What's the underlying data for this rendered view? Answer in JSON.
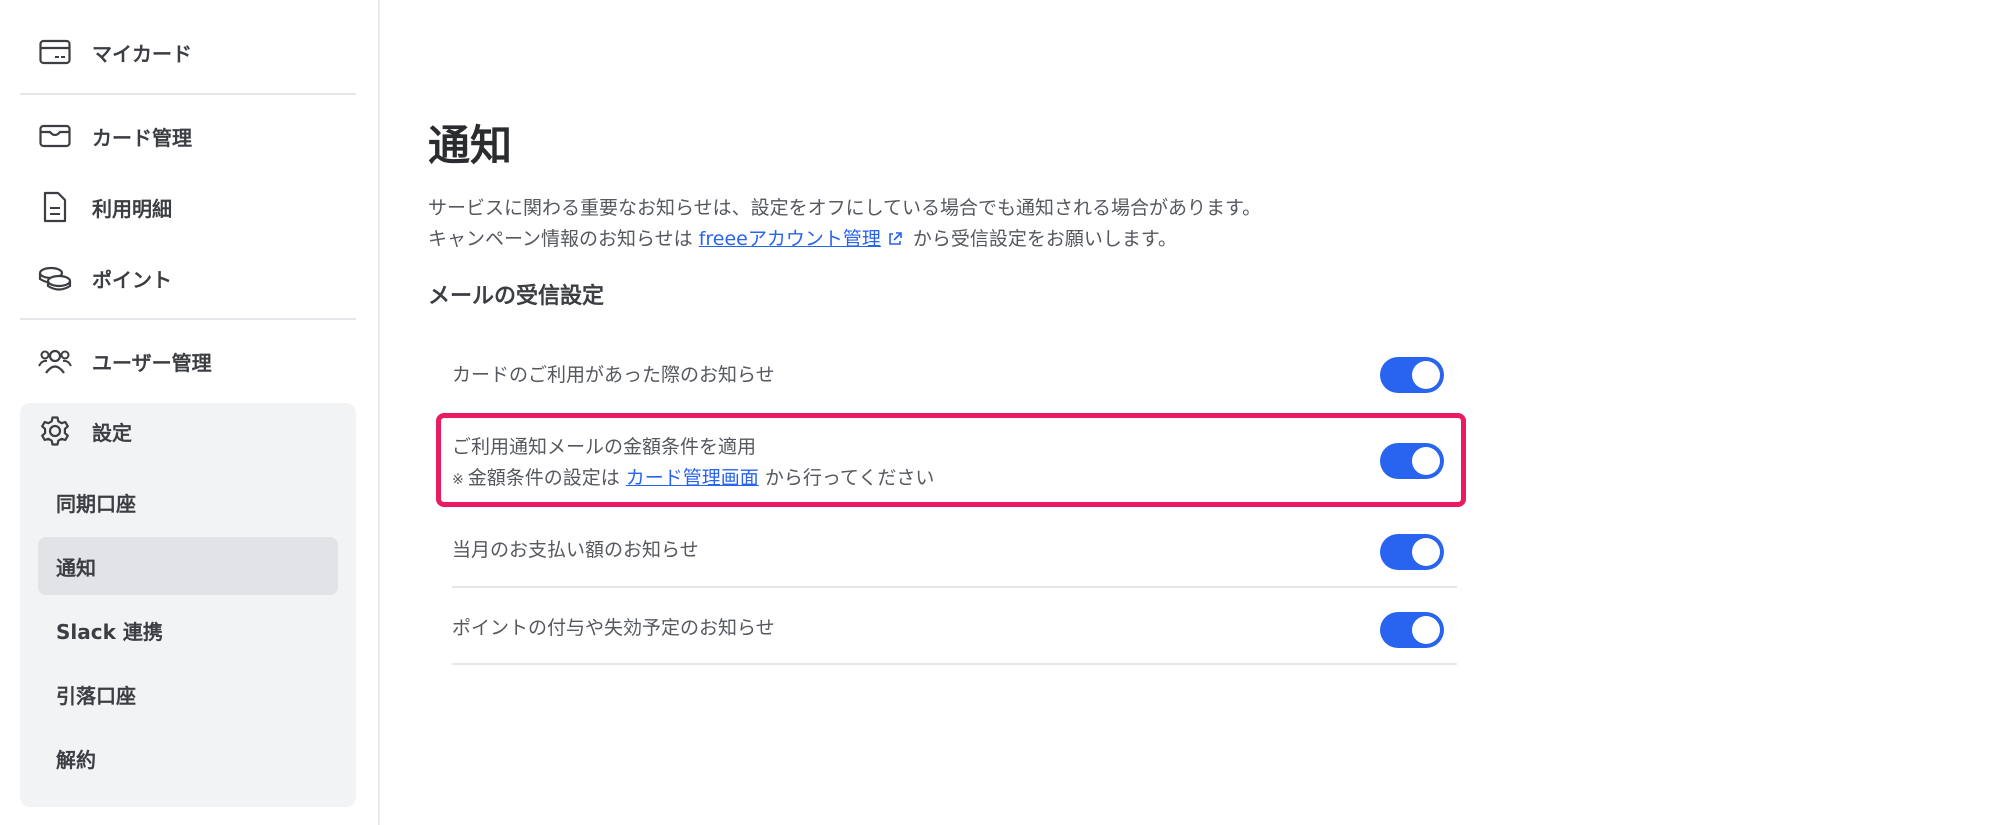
{
  "sidebar": {
    "items": [
      {
        "label": "マイカード",
        "icon": "card-icon"
      },
      {
        "label": "カード管理",
        "icon": "wallet-icon"
      },
      {
        "label": "利用明細",
        "icon": "document-icon"
      },
      {
        "label": "ポイント",
        "icon": "coins-icon"
      },
      {
        "label": "ユーザー管理",
        "icon": "users-icon"
      },
      {
        "label": "設定",
        "icon": "gear-icon"
      }
    ],
    "settings_sub": [
      {
        "label": "同期口座",
        "active": false
      },
      {
        "label": "通知",
        "active": true
      },
      {
        "label": "Slack 連携",
        "active": false
      },
      {
        "label": "引落口座",
        "active": false
      },
      {
        "label": "解約",
        "active": false
      }
    ]
  },
  "main": {
    "title": "通知",
    "description_line1": "サービスに関わる重要なお知らせは、設定をオフにしている場合でも通知される場合があります。",
    "description_line2_prefix": "キャンペーン情報のお知らせは",
    "description_link": "freeeアカウント管理",
    "description_line2_suffix": "から受信設定をお願いします。",
    "section_title": "メールの受信設定",
    "settings": [
      {
        "label": "カードのご利用があった際のお知らせ",
        "enabled": true
      },
      {
        "label": "ご利用通知メールの金額条件を適用",
        "note_prefix": "金額条件の設定は",
        "note_link": "カード管理画面",
        "note_suffix": "から行ってください",
        "note_mark": "※",
        "enabled": true,
        "highlighted": true
      },
      {
        "label": "当月のお支払い額のお知らせ",
        "enabled": true
      },
      {
        "label": "ポイントの付与や失効予定のお知らせ",
        "enabled": true
      }
    ]
  },
  "colors": {
    "accent": "#2864f0",
    "highlight": "#ea1a63"
  }
}
